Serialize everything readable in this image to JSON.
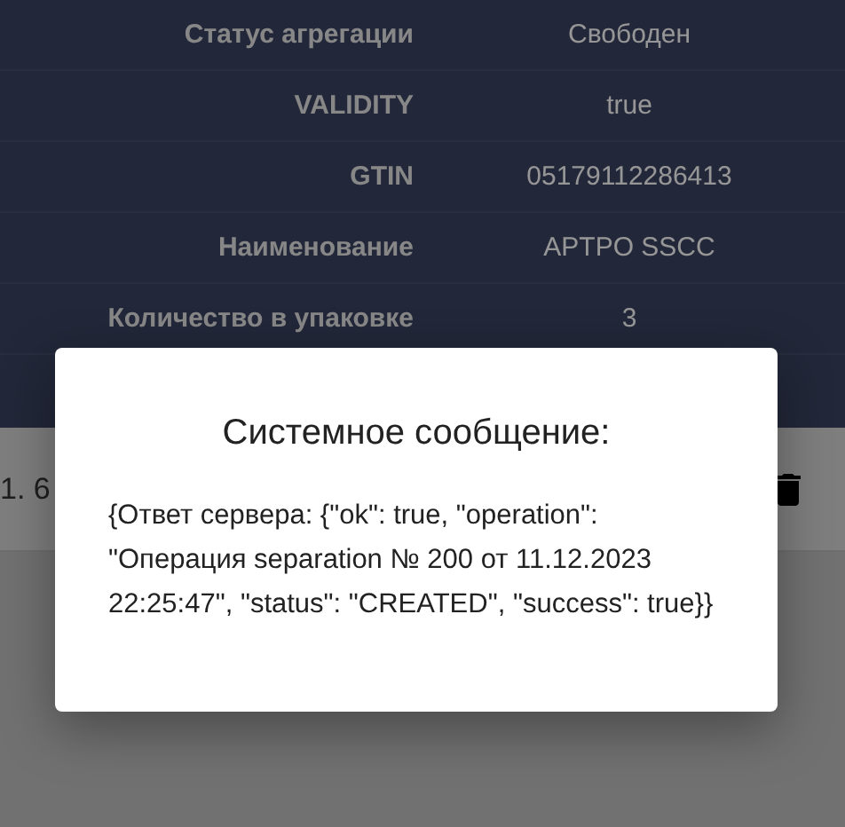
{
  "details": [
    {
      "label": "Статус агрегации",
      "value": "Свободен"
    },
    {
      "label": "VALIDITY",
      "value": "true"
    },
    {
      "label": "GTIN",
      "value": "05179112286413"
    },
    {
      "label": "Наименование",
      "value": "APTPO SSCC"
    },
    {
      "label": "Количество в упаковке",
      "value": "3"
    }
  ],
  "list_item": {
    "text": "1. 6"
  },
  "dialog": {
    "title": "Системное сообщение:",
    "message": "{Ответ сервера: {\"ok\": true, \"operation\": \"Операция separation № 200 от 11.12.2023 22:25:47\", \"status\": \"CREATED\", \"success\": true}}"
  }
}
